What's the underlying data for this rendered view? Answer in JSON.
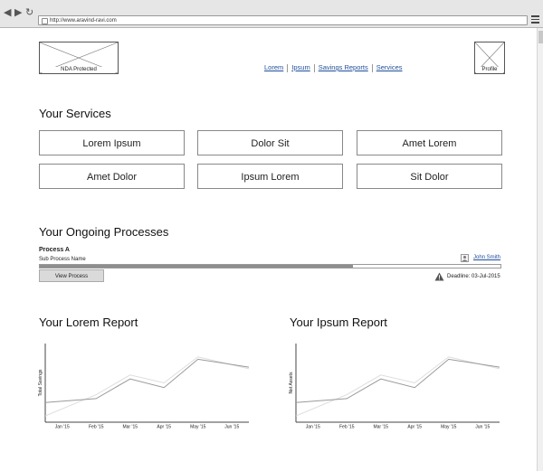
{
  "browser": {
    "url": "http://www.aravind-ravi.com"
  },
  "header": {
    "logo_label": "NDA Protected",
    "profile_label": "Profile",
    "nav": [
      "Lorem",
      "Ipsum",
      "Savings Reports",
      "Services"
    ]
  },
  "services": {
    "title": "Your Services",
    "items": [
      "Lorem Ipsum",
      "Dolor Sit",
      "Amet Lorem",
      "Amet Dolor",
      "Ipsum Lorem",
      "Sit Dolor"
    ]
  },
  "processes": {
    "title": "Your Ongoing Processes",
    "process_name": "Process A",
    "sub_process": "Sub Process Name",
    "progress": 0.68,
    "assignee": "John Smith",
    "button_label": "View Process",
    "deadline": "Deadline: 03-Jul-2015"
  },
  "chart_data": [
    {
      "type": "line",
      "title": "Your Lorem Report",
      "ylabel": "Total Savings",
      "categories": [
        "Jan '15",
        "Feb '15",
        "Mar '15",
        "Apr '15",
        "May '15",
        "Jun '15"
      ],
      "series": [
        {
          "values": [
            2.5,
            3.0,
            5.5,
            4.4,
            8.0,
            7.0
          ],
          "color": "#9a9a9a"
        },
        {
          "values": [
            0.8,
            3.5,
            6.0,
            5.0,
            8.3,
            6.8
          ],
          "color": "#dddddd"
        }
      ],
      "ylim": [
        0,
        10
      ]
    },
    {
      "type": "line",
      "title": "Your Ipsum Report",
      "ylabel": "Net Assets",
      "categories": [
        "Jan '15",
        "Feb '15",
        "Mar '15",
        "Apr '15",
        "May '15",
        "Jun '15"
      ],
      "series": [
        {
          "values": [
            2.5,
            3.0,
            5.5,
            4.4,
            8.0,
            7.0
          ],
          "color": "#9a9a9a"
        },
        {
          "values": [
            0.8,
            3.5,
            6.0,
            5.0,
            8.3,
            6.8
          ],
          "color": "#dddddd"
        }
      ],
      "ylim": [
        0,
        10
      ]
    }
  ]
}
